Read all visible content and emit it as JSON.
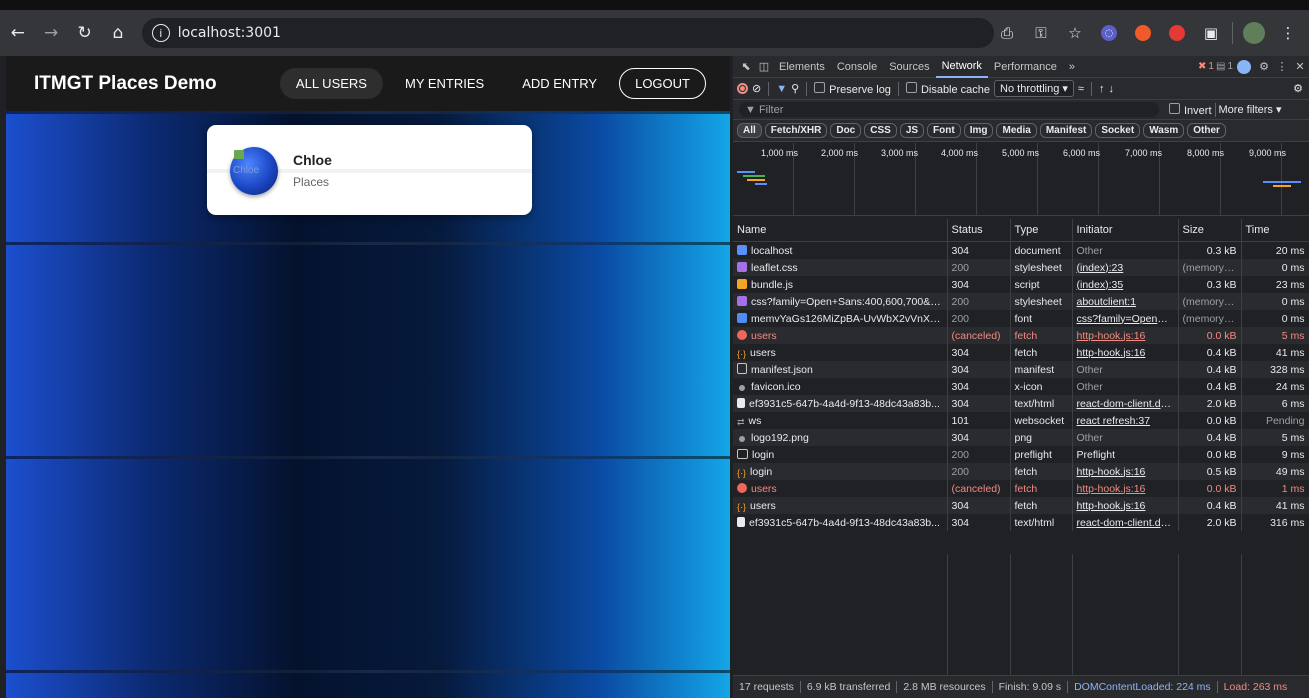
{
  "browser": {
    "url": "localhost:3001",
    "colors": {
      "toolbar": "#35363a",
      "omnibox": "#202124"
    }
  },
  "app": {
    "title": "ITMGT Places Demo",
    "nav": [
      {
        "label": "ALL USERS",
        "state": "active"
      },
      {
        "label": "MY ENTRIES",
        "state": "normal"
      },
      {
        "label": "ADD ENTRY",
        "state": "normal"
      },
      {
        "label": "LOGOUT",
        "state": "outlined"
      }
    ],
    "users": [
      {
        "name": "Chloe",
        "places_label": "Places",
        "avatar_alt": "Chloe"
      }
    ]
  },
  "devtools": {
    "tabs": [
      "Elements",
      "Console",
      "Sources",
      "Network",
      "Performance"
    ],
    "active_tab": "Network",
    "more_tabs": "»",
    "error_count": "1",
    "warning_count": "1",
    "toolbar": {
      "preserve_log": "Preserve log",
      "disable_cache": "Disable cache",
      "throttling": "No throttling"
    },
    "filter": {
      "placeholder": "Filter",
      "invert": "Invert",
      "more_filters": "More filters"
    },
    "type_filters": [
      "All",
      "Fetch/XHR",
      "Doc",
      "CSS",
      "JS",
      "Font",
      "Img",
      "Media",
      "Manifest",
      "Socket",
      "Wasm",
      "Other"
    ],
    "timeline_ticks": [
      "1,000 ms",
      "2,000 ms",
      "3,000 ms",
      "4,000 ms",
      "5,000 ms",
      "6,000 ms",
      "7,000 ms",
      "8,000 ms",
      "9,000 ms"
    ],
    "columns": [
      "Name",
      "Status",
      "Type",
      "Initiator",
      "Size",
      "Time"
    ],
    "rows": [
      {
        "icon": "doc",
        "name": "localhost",
        "status": "304",
        "type": "document",
        "initiator": "Other",
        "initiator_link": false,
        "size": "0.3 kB",
        "time": "20 ms",
        "error": false
      },
      {
        "icon": "css",
        "name": "leaflet.css",
        "status": "200",
        "type": "stylesheet",
        "initiator": "(index):23",
        "initiator_link": true,
        "size": "(memory c...",
        "time": "0 ms",
        "error": false
      },
      {
        "icon": "js",
        "name": "bundle.js",
        "status": "304",
        "type": "script",
        "initiator": "(index):35",
        "initiator_link": true,
        "size": "0.3 kB",
        "time": "23 ms",
        "error": false
      },
      {
        "icon": "css",
        "name": "css?family=Open+Sans:400,600,700&di...",
        "status": "200",
        "type": "stylesheet",
        "initiator": "aboutclient:1",
        "initiator_link": true,
        "size": "(memory c...",
        "time": "0 ms",
        "error": false
      },
      {
        "icon": "font",
        "name": "memvYaGs126MiZpBA-UvWbX2vVnXBb...",
        "status": "200",
        "type": "font",
        "initiator": "css?family=Open+Sans",
        "initiator_link": true,
        "size": "(memory c...",
        "time": "0 ms",
        "error": false
      },
      {
        "icon": "err",
        "name": "users",
        "status": "(canceled)",
        "type": "fetch",
        "initiator": "http-hook.js:16",
        "initiator_link": true,
        "size": "0.0 kB",
        "time": "5 ms",
        "error": true
      },
      {
        "icon": "fetch",
        "name": "users",
        "status": "304",
        "type": "fetch",
        "initiator": "http-hook.js:16",
        "initiator_link": true,
        "size": "0.4 kB",
        "time": "41 ms",
        "error": false
      },
      {
        "icon": "file",
        "name": "manifest.json",
        "status": "304",
        "type": "manifest",
        "initiator": "Other",
        "initiator_link": false,
        "size": "0.4 kB",
        "time": "328 ms",
        "error": false
      },
      {
        "icon": "dot",
        "name": "favicon.ico",
        "status": "304",
        "type": "x-icon",
        "initiator": "Other",
        "initiator_link": false,
        "size": "0.4 kB",
        "time": "24 ms",
        "error": false
      },
      {
        "icon": "html",
        "name": "ef3931c5-647b-4a4d-9f13-48dc43a83b...",
        "status": "304",
        "type": "text/html",
        "initiator": "react-dom-client.devel",
        "initiator_link": true,
        "size": "2.0 kB",
        "time": "6 ms",
        "error": false
      },
      {
        "icon": "ws",
        "name": "ws",
        "status": "101",
        "type": "websocket",
        "initiator": "react refresh:37",
        "initiator_link": true,
        "size": "0.0 kB",
        "time": "Pending",
        "error": false
      },
      {
        "icon": "dot",
        "name": "logo192.png",
        "status": "304",
        "type": "png",
        "initiator": "Other",
        "initiator_link": false,
        "size": "0.4 kB",
        "time": "5 ms",
        "error": false
      },
      {
        "icon": "pf",
        "name": "login",
        "status": "200",
        "type": "preflight",
        "initiator": "Preflight",
        "initiator_link": false,
        "size": "0.0 kB",
        "time": "9 ms",
        "error": false
      },
      {
        "icon": "fetch",
        "name": "login",
        "status": "200",
        "type": "fetch",
        "initiator": "http-hook.js:16",
        "initiator_link": true,
        "size": "0.5 kB",
        "time": "49 ms",
        "error": false
      },
      {
        "icon": "err",
        "name": "users",
        "status": "(canceled)",
        "type": "fetch",
        "initiator": "http-hook.js:16",
        "initiator_link": true,
        "size": "0.0 kB",
        "time": "1 ms",
        "error": true
      },
      {
        "icon": "fetch",
        "name": "users",
        "status": "304",
        "type": "fetch",
        "initiator": "http-hook.js:16",
        "initiator_link": true,
        "size": "0.4 kB",
        "time": "41 ms",
        "error": false
      },
      {
        "icon": "html",
        "name": "ef3931c5-647b-4a4d-9f13-48dc43a83b...",
        "status": "304",
        "type": "text/html",
        "initiator": "react-dom-client.devel",
        "initiator_link": true,
        "size": "2.0 kB",
        "time": "316 ms",
        "error": false
      }
    ],
    "summary": {
      "requests": "17 requests",
      "transferred": "6.9 kB transferred",
      "resources": "2.8 MB resources",
      "finish": "Finish: 9.09 s",
      "dom_content_loaded": "DOMContentLoaded: 224 ms",
      "load": "Load: 263 ms"
    }
  }
}
